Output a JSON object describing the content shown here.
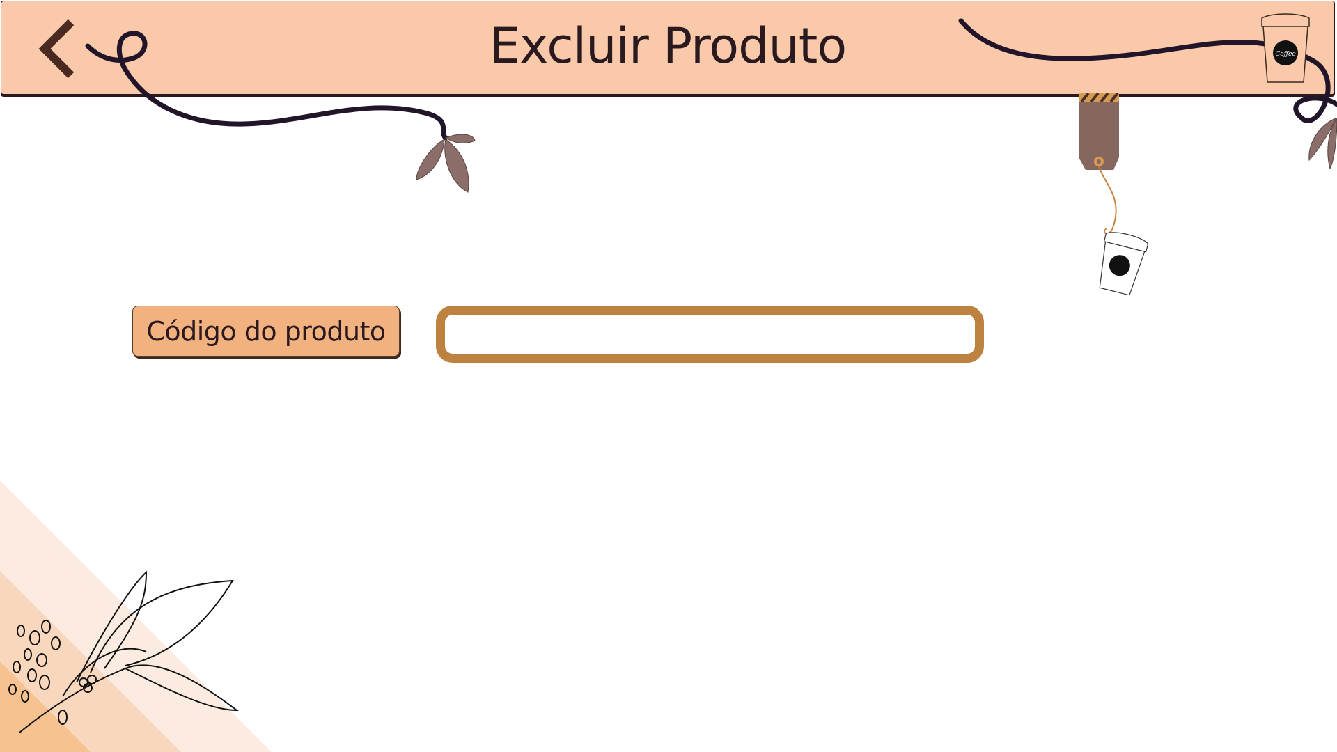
{
  "header": {
    "title": "Excluir Produto",
    "back_icon": "chevron-left-icon"
  },
  "form": {
    "code_label": "Código do produto",
    "code_input_value": "",
    "code_input_placeholder": ""
  },
  "decorations": {
    "cup_logo_text": "Coffee",
    "icons": [
      "coffee-cup-icon",
      "hanging-tag-icon",
      "coffee-branch-icon",
      "vine-leaf-icon"
    ]
  },
  "colors": {
    "header_bg": "#f9c9aa",
    "label_bg": "#f1b27f",
    "input_border": "#bd8240",
    "text_dark": "#2a1a20",
    "tag_brown": "#866760"
  }
}
